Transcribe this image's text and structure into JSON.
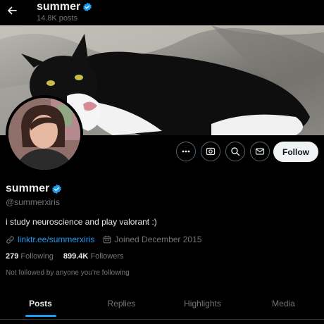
{
  "header": {
    "name": "summer",
    "posts_count": "14.8K posts"
  },
  "banner": {
    "description_icon": "cat-photo"
  },
  "profile": {
    "name": "summer",
    "handle": "@summerxiris",
    "bio": "i study neuroscience and play valorant :)",
    "link": "linktr.ee/summerxiris",
    "joined": "Joined December 2015",
    "following_count": "279",
    "following_label": "Following",
    "followers_count": "899.4K",
    "followers_label": "Followers",
    "mutuals_note": "Not followed by anyone you’re following",
    "follow_label": "Follow"
  },
  "tabs": [
    {
      "label": "Posts"
    },
    {
      "label": "Replies"
    },
    {
      "label": "Highlights"
    },
    {
      "label": "Media"
    }
  ],
  "colors": {
    "accent": "#1d9bf0",
    "muted": "#71767b",
    "text": "#e7e9ea",
    "background": "#000000"
  }
}
